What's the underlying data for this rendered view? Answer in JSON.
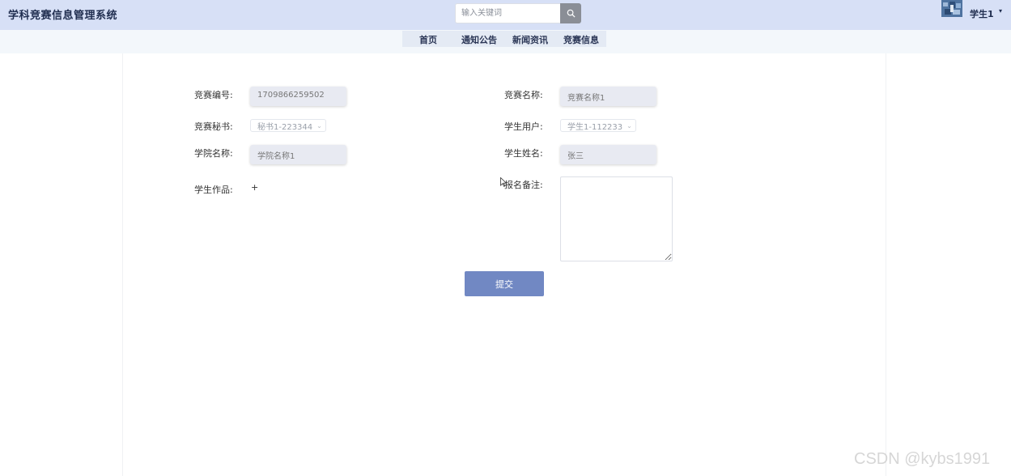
{
  "header": {
    "app_title": "学科竞赛信息管理系统",
    "search_placeholder": "输入关键词",
    "user_name": "学生1",
    "caret": "▾"
  },
  "nav": {
    "items": [
      {
        "label": "首页"
      },
      {
        "label": "通知公告"
      },
      {
        "label": "新闻资讯"
      },
      {
        "label": "竞赛信息"
      }
    ]
  },
  "form": {
    "competition_no": {
      "label": "竞赛编号:",
      "value": "1709866259502"
    },
    "competition_name": {
      "label": "竞赛名称:",
      "value": "竞赛名称1"
    },
    "secretary": {
      "label": "竞赛秘书:",
      "value": "秘书1-223344"
    },
    "student_user": {
      "label": "学生用户:",
      "value": "学生1-112233"
    },
    "college_name": {
      "label": "学院名称:",
      "value": "学院名称1"
    },
    "student_name": {
      "label": "学生姓名:",
      "value": "张三"
    },
    "student_work": {
      "label": "学生作品:",
      "add": "+"
    },
    "remark": {
      "label": "报名备注:",
      "value": ""
    },
    "submit_label": "提交"
  },
  "watermark": "CSDN @kybs1991",
  "colors": {
    "header_bg": "#d7e0f6",
    "nav_bg": "#e4eaf4",
    "submit_bg": "#7188c3"
  }
}
